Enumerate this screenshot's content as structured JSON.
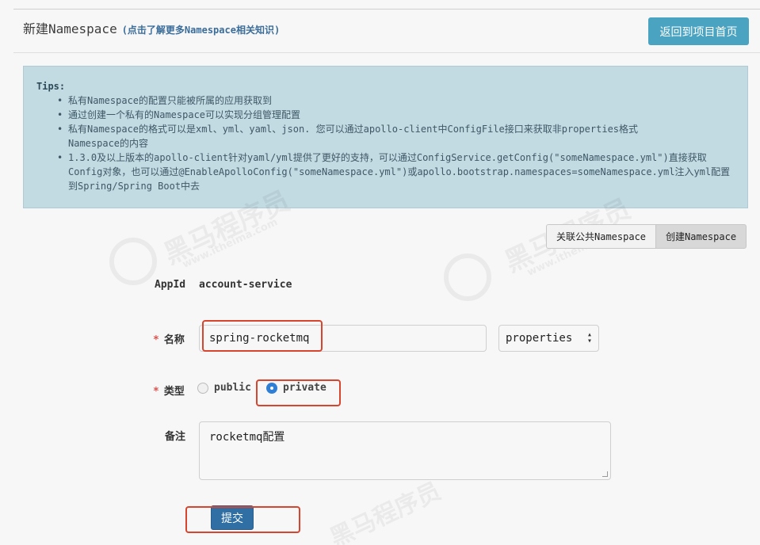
{
  "header": {
    "title": "新建Namespace",
    "help_link": "(点击了解更多Namespace相关知识)",
    "back_button": "返回到项目首页"
  },
  "tips": {
    "title": "Tips:",
    "items": [
      "私有Namespace的配置只能被所属的应用获取到",
      "通过创建一个私有的Namespace可以实现分组管理配置",
      "私有Namespace的格式可以是xml、yml、yaml、json. 您可以通过apollo-client中ConfigFile接口来获取非properties格式Namespace的内容",
      "1.3.0及以上版本的apollo-client针对yaml/yml提供了更好的支持，可以通过ConfigService.getConfig(\"someNamespace.yml\")直接获取Config对象，也可以通过@EnableApolloConfig(\"someNamespace.yml\")或apollo.bootstrap.namespaces=someNamespace.yml注入yml配置到Spring/Spring Boot中去"
    ]
  },
  "tabs": {
    "link_public": "关联公共Namespace",
    "create": "创建Namespace"
  },
  "form": {
    "appid_label": "AppId",
    "appid_value": "account-service",
    "required_mark": "*",
    "name_label": "名称",
    "name_value": "spring-rocketmq",
    "format_value": "properties",
    "type_label": "类型",
    "type_public": "public",
    "type_private": "private",
    "type_selected": "private",
    "comment_label": "备注",
    "comment_value": "rocketmq配置",
    "submit": "提交"
  },
  "watermark": {
    "brand": "黑马程序员",
    "site": "www.itheima.com"
  },
  "colors": {
    "accent": "#4aa3c0",
    "submit": "#2f6fa3",
    "highlight": "#d8452e",
    "tips_bg": "#c2dae2"
  }
}
